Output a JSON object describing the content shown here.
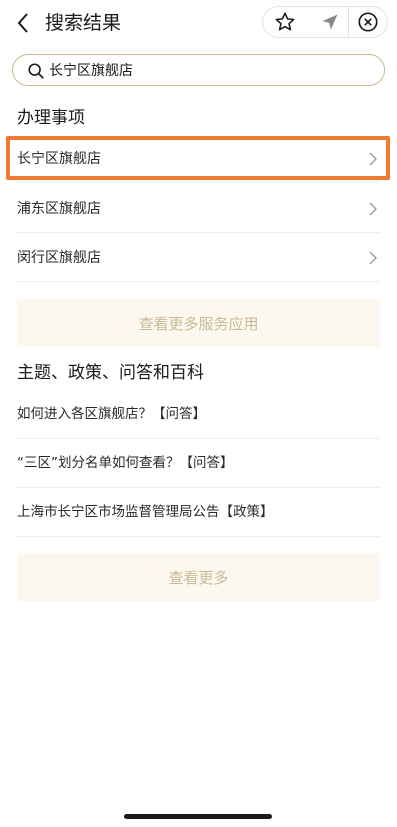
{
  "header": {
    "title": "搜索结果",
    "back_icon": "chevron-left-icon",
    "actions": [
      "star-icon",
      "navigation-arrow-icon",
      "close-circle-icon"
    ]
  },
  "search": {
    "value": "长宁区旗舰店",
    "icon": "search-icon"
  },
  "services": {
    "title": "办理事项",
    "items": [
      {
        "label": "长宁区旗舰店"
      },
      {
        "label": "浦东区旗舰店"
      },
      {
        "label": "闵行区旗舰店"
      }
    ],
    "more_label": "查看更多服务应用"
  },
  "topics": {
    "title": "主题、政策、问答和百科",
    "items": [
      {
        "label": "如何进入各区旗舰店？【问答】"
      },
      {
        "label": "“三区”划分名单如何查看？【问答】"
      },
      {
        "label": "上海市长宁区市场监督管理局公告【政策】"
      }
    ],
    "more_label": "查看更多"
  },
  "colors": {
    "highlight": "#f07a32",
    "search_border": "#c9b98d",
    "more_bg": "#fcf8ef",
    "more_text": "#cbb994"
  }
}
